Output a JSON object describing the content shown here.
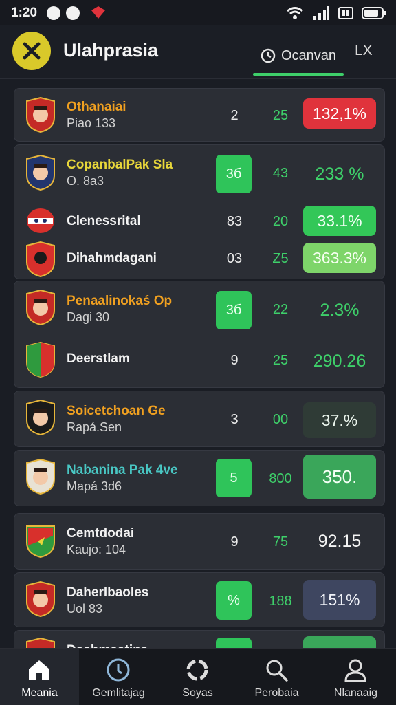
{
  "status": {
    "time": "1:20",
    "colors": {
      "accent": "#3ecf6a",
      "red": "#e0333c"
    }
  },
  "header": {
    "title": "Ulahprasia",
    "tab_label": "Ocanvan",
    "close_label": "LX"
  },
  "cards": [
    {
      "rows": [
        {
          "name": "Othanaiai",
          "sub": "Piao 133",
          "num1": "2",
          "num2": "25",
          "pct": "132,1%",
          "name_color": "#f0a020",
          "pct_style": "red"
        }
      ]
    },
    {
      "rows": [
        {
          "name": "CopanbalPak Sla",
          "sub": "O. 8a3",
          "num1": "3б",
          "num2": "43",
          "pct": "233 %",
          "name_color": "#e7d63a",
          "pct_style": "plain-green",
          "chip": true
        },
        {
          "name": "Clenessrital",
          "sub": "",
          "num1": "83",
          "num2": "20",
          "pct": "33.1%",
          "name_color": "#f2f2f2",
          "pct_style": "green"
        },
        {
          "name": "Dihahmdagani",
          "sub": "",
          "num1": "03",
          "num2": "Z5",
          "pct": "363.3%",
          "name_color": "#f2f2f2",
          "pct_style": "lightgreen"
        }
      ]
    },
    {
      "rows": [
        {
          "name": "Penaalinokaś Op",
          "sub": "Dagi 30",
          "num1": "3б",
          "num2": "22",
          "pct": "2.3%",
          "name_color": "#f0a020",
          "pct_style": "plain-green",
          "chip": true
        },
        {
          "name": "Deerstlam",
          "sub": "",
          "num1": "9",
          "num2": "25",
          "pct": "290.26",
          "name_color": "#f2f2f2",
          "pct_style": "plain-green"
        }
      ]
    },
    {
      "rows": [
        {
          "name": "Soicetchoan Ge",
          "sub": "Rapá.Sen",
          "num1": "3",
          "num2": "00",
          "pct": "37.%",
          "name_color": "#f0a020",
          "pct_style": "dark"
        }
      ]
    },
    {
      "rows": [
        {
          "name": "Nabanina Pak 4ve",
          "sub": "Mapá 3d6",
          "num1": "5",
          "num2": "800",
          "pct": "350.",
          "name_color": "#49c7c4",
          "pct_style": "green",
          "chip": true
        }
      ]
    },
    {
      "rows": [
        {
          "name": "Cemtdodai",
          "sub": "Kaujo: 104",
          "num1": "9",
          "num2": "75",
          "pct": "92.15",
          "name_color": "#f2f2f2",
          "pct_style": "plain-white"
        }
      ]
    },
    {
      "rows": [
        {
          "name": "Daherlbaoles",
          "sub": "Uol 83",
          "num1": "%",
          "num2": "188",
          "pct": "151%",
          "name_color": "#f2f2f2",
          "pct_style": "slate",
          "chip": true
        }
      ]
    },
    {
      "rows": [
        {
          "name": "Dashmaatina",
          "sub": "",
          "num1": "",
          "num2": "",
          "pct": "",
          "name_color": "#f2f2f2",
          "pct_style": "green",
          "chip": true
        }
      ]
    }
  ],
  "tabbar": [
    {
      "label": "Meania",
      "icon": "home-icon"
    },
    {
      "label": "Gemlitajag",
      "icon": "clock-icon"
    },
    {
      "label": "Soyas",
      "icon": "refresh-icon"
    },
    {
      "label": "Perobaia",
      "icon": "search-icon"
    },
    {
      "label": "Nlanaaig",
      "icon": "profile-icon"
    }
  ]
}
